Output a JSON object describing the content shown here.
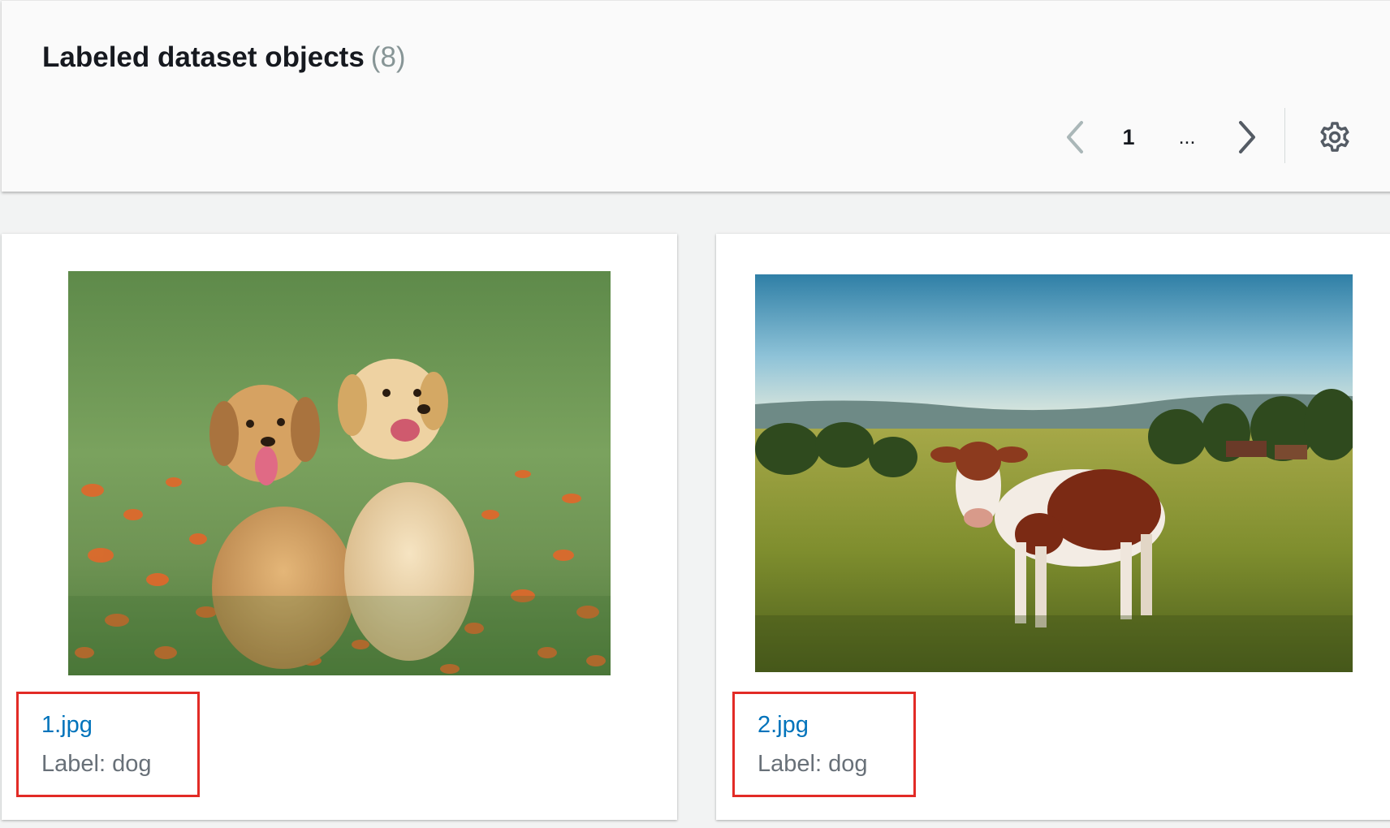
{
  "header": {
    "title": "Labeled dataset objects",
    "count": "(8)"
  },
  "pagination": {
    "current_page": "1",
    "ellipsis": "...",
    "prev_icon": "chevron-left-icon",
    "next_icon": "chevron-right-icon"
  },
  "settings": {
    "icon": "gear-icon"
  },
  "cards": [
    {
      "filename": "1.jpg",
      "label": "Label: dog",
      "image": "two-puppies-in-flower-field"
    },
    {
      "filename": "2.jpg",
      "label": "Label: dog",
      "image": "cow-in-pasture"
    }
  ],
  "colors": {
    "link": "#0073bb",
    "label": "#687078",
    "highlight_border": "#e22b26",
    "title": "#16191f",
    "count": "#879596"
  }
}
